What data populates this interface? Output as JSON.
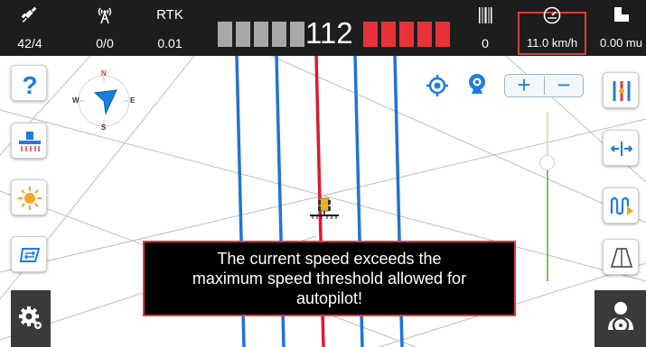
{
  "status_bar": {
    "satellite": {
      "icon": "satellite-icon",
      "value": "42/4"
    },
    "signal": {
      "icon": "radio-signal-icon",
      "value": "0/0"
    },
    "rtk": {
      "label": "RTK",
      "value": "0.01"
    },
    "center_count": "112",
    "right_stat": {
      "icon": "barcode-icon",
      "value": "0"
    },
    "speed": {
      "icon": "speedometer-icon",
      "value": "11.0 km/h"
    },
    "area": {
      "icon": "area-icon",
      "value": "0.00 mu"
    },
    "colors": {
      "left_blocks": "#a8a8a8",
      "right_blocks": "#e8323a",
      "highlight": "#e23a3a"
    }
  },
  "compass": {
    "n": "N",
    "s": "S",
    "e": "E",
    "w": "W"
  },
  "left_toolbar": [
    {
      "icon": "help-icon"
    },
    {
      "icon": "implement-icon"
    },
    {
      "icon": "brightness-icon"
    },
    {
      "icon": "swap-icon"
    }
  ],
  "right_toolbar": [
    {
      "icon": "guidance-lines-icon"
    },
    {
      "icon": "width-adjust-icon"
    },
    {
      "icon": "curve-path-icon"
    },
    {
      "icon": "perspective-view-icon"
    }
  ],
  "map_controls": {
    "locate_icon": "locate-icon",
    "camera_icon": "camera-icon",
    "zoom_in": "+",
    "zoom_out": "−"
  },
  "alert": {
    "lines": [
      "The current speed exceeds the",
      "maximum speed threshold allowed for",
      "autopilot!"
    ]
  },
  "bottom": {
    "settings_icon": "settings-gear-icon",
    "driver_icon": "driver-icon"
  }
}
